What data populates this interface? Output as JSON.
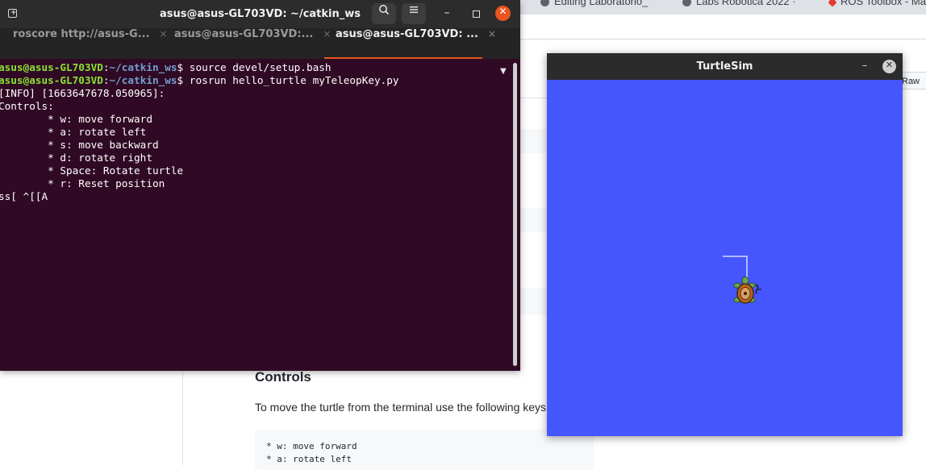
{
  "browser": {
    "tabs": [
      {
        "label": "Editing Laboratorio_"
      },
      {
        "label": "Labs Robotica 2022 ·"
      },
      {
        "label": "ROS Toolbox - Ma"
      }
    ],
    "raw_label": "Raw",
    "controls_heading": "Controls",
    "instructions": "To move the turtle from the terminal use the following keys",
    "code_lines": [
      "* w: move forward",
      "* a: rotate left"
    ]
  },
  "terminal": {
    "title": "asus@asus-GL703VD: ~/catkin_ws",
    "tabs": [
      {
        "label": "roscore http://asus-G...",
        "close": "×"
      },
      {
        "label": "asus@asus-GL703VD:...",
        "close": "×"
      },
      {
        "label": "asus@asus-GL703VD: ...",
        "close": "×"
      }
    ],
    "prompt_user": "asus@asus-GL703VD",
    "prompt_sep": ":",
    "prompt_path": "~/catkin_ws",
    "prompt_sign": "$",
    "cmd1": " source devel/setup.bash",
    "cmd2": " rosrun hello_turtle myTeleopKey.py",
    "output": [
      "[INFO] [1663647678.050965]:",
      "Controls:",
      "        * w: move forward",
      "        * a: rotate left",
      "        * s: move backward",
      "        * d: rotate right",
      "        * Space: Rotate turtle",
      "        * r: Reset position",
      "ss[ ^[[A"
    ],
    "icons": {
      "new_tab": "new-tab-icon",
      "search": "search-icon",
      "menu": "hamburger-menu-icon",
      "minimize": "minimize-icon",
      "maximize": "maximize-icon",
      "close": "close-icon"
    }
  },
  "turtlesim": {
    "title": "TurtleSim",
    "background": "#4556ff",
    "trail_color": "#b3b9ff"
  }
}
